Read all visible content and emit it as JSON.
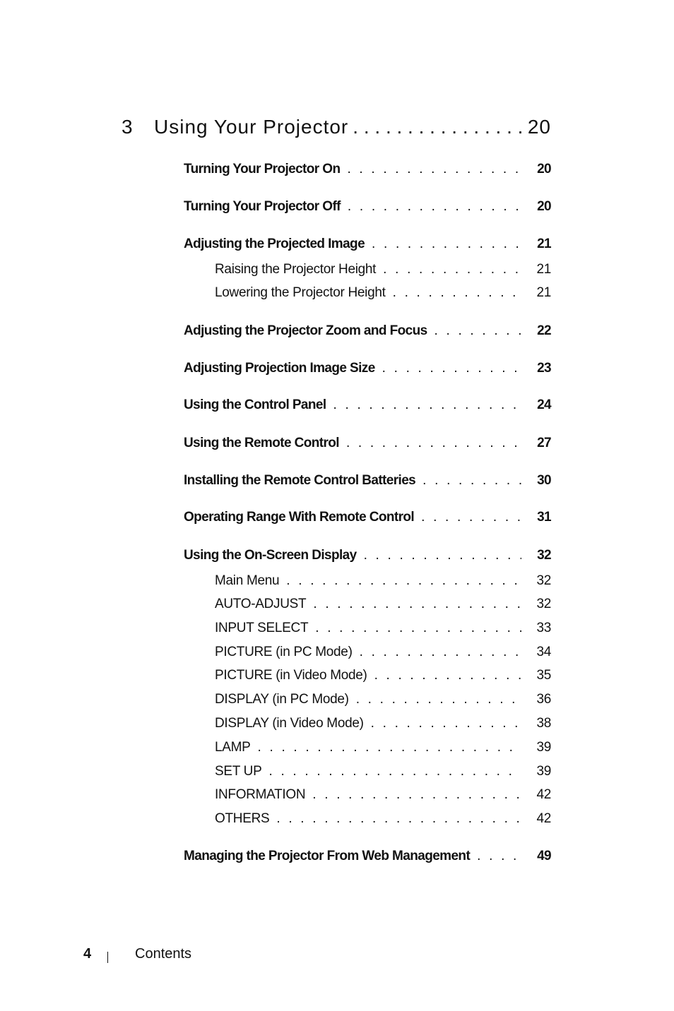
{
  "chapter": {
    "number": "3",
    "title": "Using Your Projector",
    "page": "20"
  },
  "entries": [
    {
      "label": "Turning Your Projector On",
      "page": "20",
      "level": 1
    },
    {
      "label": "Turning Your Projector Off",
      "page": "20",
      "level": 1
    },
    {
      "label": "Adjusting the Projected Image",
      "page": "21",
      "level": 1
    },
    {
      "label": "Raising the Projector Height",
      "page": "21",
      "level": 2
    },
    {
      "label": "Lowering the Projector Height",
      "page": "21",
      "level": 2
    },
    {
      "label": "Adjusting the Projector Zoom and Focus",
      "page": "22",
      "level": 1
    },
    {
      "label": "Adjusting Projection Image Size",
      "page": "23",
      "level": 1
    },
    {
      "label": "Using the Control Panel",
      "page": "24",
      "level": 1
    },
    {
      "label": "Using the Remote Control",
      "page": "27",
      "level": 1
    },
    {
      "label": "Installing the Remote Control Batteries",
      "page": "30",
      "level": 1
    },
    {
      "label": "Operating Range With Remote Control",
      "page": "31",
      "level": 1
    },
    {
      "label": "Using the On-Screen Display",
      "page": "32",
      "level": 1
    },
    {
      "label": "Main Menu",
      "page": "32",
      "level": 2
    },
    {
      "label": "AUTO-ADJUST",
      "page": "32",
      "level": 2
    },
    {
      "label": "INPUT SELECT",
      "page": "33",
      "level": 2
    },
    {
      "label": "PICTURE (in PC Mode)",
      "page": "34",
      "level": 2
    },
    {
      "label": "PICTURE (in Video Mode)",
      "page": "35",
      "level": 2
    },
    {
      "label": "DISPLAY (in PC Mode)",
      "page": "36",
      "level": 2
    },
    {
      "label": "DISPLAY (in Video Mode)",
      "page": "38",
      "level": 2
    },
    {
      "label": "LAMP",
      "page": "39",
      "level": 2
    },
    {
      "label": "SET UP",
      "page": "39",
      "level": 2
    },
    {
      "label": "INFORMATION",
      "page": "42",
      "level": 2
    },
    {
      "label": "OTHERS",
      "page": "42",
      "level": 2
    },
    {
      "label": "Managing the Projector From Web Management",
      "page": "49",
      "level": 1
    }
  ],
  "footer": {
    "page_number": "4",
    "section": "Contents"
  }
}
